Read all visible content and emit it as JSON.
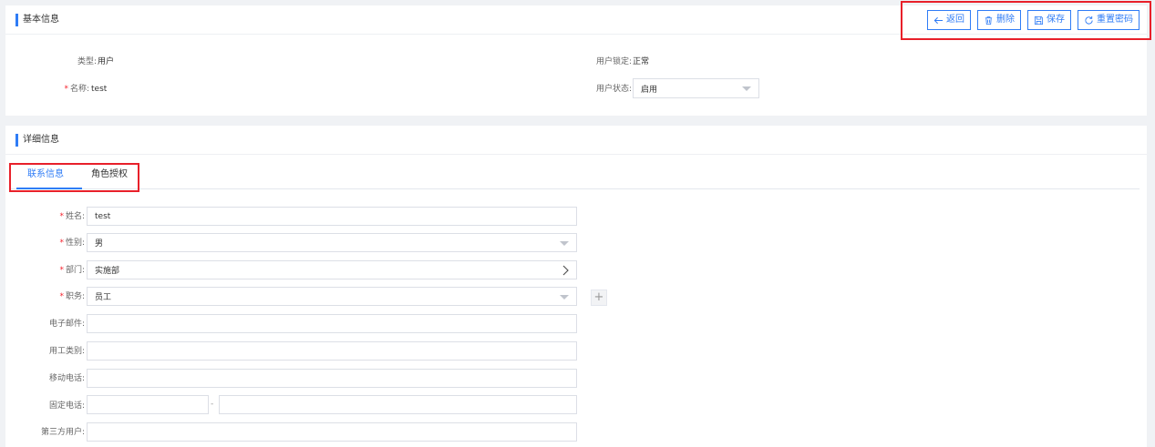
{
  "basic": {
    "title": "基本信息",
    "toolbar": {
      "back_label": "返回",
      "delete_label": "删除",
      "save_label": "保存",
      "reset_label": "重置密码"
    },
    "type_label": "类型:",
    "type_value": "用户",
    "name_label": "名称:",
    "name_value": "test",
    "lock_label": "用户锁定:",
    "lock_value": "正常",
    "status_label": "用户状态:",
    "status_value": "启用"
  },
  "detail": {
    "title": "详细信息",
    "tabs": [
      {
        "label": "联系信息",
        "active": true
      },
      {
        "label": "角色授权",
        "active": false
      }
    ],
    "form": {
      "fullname_label": "姓名:",
      "fullname_value": "test",
      "gender_label": "性别:",
      "gender_value": "男",
      "dept_label": "部门:",
      "dept_value": "实施部",
      "position_label": "职务:",
      "position_value": "员工",
      "email_label": "电子邮件:",
      "email_value": "",
      "worktype_label": "用工类别:",
      "worktype_value": "",
      "mobile_label": "移动电话:",
      "mobile_value": "",
      "phone_label": "固定电话:",
      "phone_area_value": "",
      "phone_sep": "-",
      "phone_number_value": "",
      "third_label": "第三方用户:",
      "third_value": ""
    }
  },
  "colors": {
    "accent": "#2f7cf6",
    "required": "#f5222d",
    "annotation": "#e8202a",
    "background": "#f0f2f5"
  }
}
